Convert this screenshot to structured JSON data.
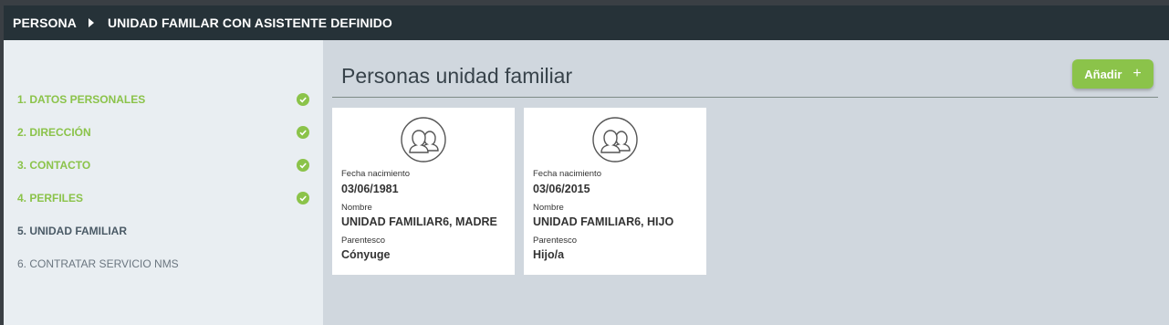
{
  "breadcrumb": {
    "root": "PERSONA",
    "current": "UNIDAD FAMILAR CON ASISTENTE DEFINIDO"
  },
  "steps": [
    {
      "label": "1. DATOS PERSONALES",
      "status": "done"
    },
    {
      "label": "2. DIRECCIÓN",
      "status": "done"
    },
    {
      "label": "3. CONTACTO",
      "status": "done"
    },
    {
      "label": "4. PERFILES",
      "status": "done"
    },
    {
      "label": "5. UNIDAD FAMILIAR",
      "status": "current"
    },
    {
      "label": "6. CONTRATAR SERVICIO NMS",
      "status": "pending"
    }
  ],
  "main": {
    "title": "Personas unidad familiar",
    "add_label": "Añadir",
    "add_icon": "plus-icon"
  },
  "members": [
    {
      "birth_label": "Fecha nacimiento",
      "birth": "03/06/1981",
      "name_label": "Nombre",
      "name": "UNIDAD FAMILIAR6, MADRE",
      "relation_label": "Parentesco",
      "relation": "Cónyuge"
    },
    {
      "birth_label": "Fecha nacimiento",
      "birth": "03/06/2015",
      "name_label": "Nombre",
      "name": "UNIDAD FAMILIAR6, HIJO",
      "relation_label": "Parentesco",
      "relation": "Hijo/a"
    }
  ],
  "colors": {
    "topbar": "#263238",
    "accent": "#8bc34a",
    "sidebar": "#e9eef2",
    "main_bg": "#d0d7de"
  }
}
